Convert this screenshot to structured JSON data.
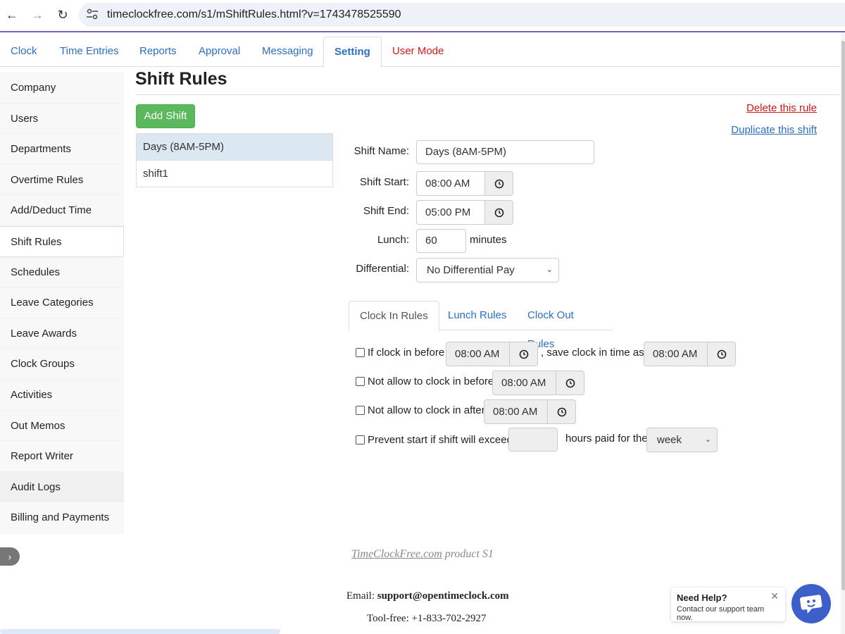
{
  "browser": {
    "url": "timeclockfree.com/s1/mShiftRules.html?v=1743478525590",
    "back_icon": "←",
    "forward_icon": "→",
    "reload_icon": "↻"
  },
  "top_tabs": [
    {
      "label": "Clock"
    },
    {
      "label": "Time Entries"
    },
    {
      "label": "Reports"
    },
    {
      "label": "Approval"
    },
    {
      "label": "Messaging"
    },
    {
      "label": "Setting",
      "active": true
    },
    {
      "label": "User Mode"
    }
  ],
  "sidebar": {
    "items": [
      {
        "label": "Company"
      },
      {
        "label": "Users"
      },
      {
        "label": "Departments"
      },
      {
        "label": "Overtime Rules"
      },
      {
        "label": "Add/Deduct Time"
      },
      {
        "label": "Shift Rules",
        "active": true
      },
      {
        "label": "Schedules"
      },
      {
        "label": "Leave Categories"
      },
      {
        "label": "Leave Awards"
      },
      {
        "label": "Clock Groups"
      },
      {
        "label": "Activities"
      },
      {
        "label": "Out Memos"
      },
      {
        "label": "Report Writer"
      },
      {
        "label": "Audit Logs"
      },
      {
        "label": "Billing and Payments"
      }
    ],
    "toggle_icon": "›"
  },
  "page": {
    "title": "Shift Rules",
    "add_shift_label": "Add Shift",
    "delete_link": "Delete this rule",
    "duplicate_link": "Duplicate this shift"
  },
  "shifts": [
    {
      "name": "Days (8AM-5PM)",
      "selected": true
    },
    {
      "name": "shift1"
    }
  ],
  "form": {
    "shift_name_label": "Shift Name:",
    "shift_name_value": "Days (8AM-5PM)",
    "shift_start_label": "Shift Start:",
    "shift_start_value": "08:00 AM",
    "shift_end_label": "Shift End:",
    "shift_end_value": "05:00 PM",
    "lunch_label": "Lunch:",
    "lunch_value": "60",
    "lunch_unit": "minutes",
    "differential_label": "Differential:",
    "differential_value": "No Differential Pay"
  },
  "rule_tabs": [
    {
      "label": "Clock In Rules",
      "active": true
    },
    {
      "label": "Lunch Rules"
    },
    {
      "label": "Clock Out Rules"
    }
  ],
  "clock_in_rules": {
    "rule1_label": "If clock in before",
    "rule1_time": "08:00 AM",
    "rule1_mid": ", save clock in time as",
    "rule1_time2": "08:00 AM",
    "rule2_label": "Not allow to clock in before",
    "rule2_time": "08:00 AM",
    "rule3_label": "Not allow to clock in after",
    "rule3_time": "08:00 AM",
    "rule4_label": "Prevent start if shift will exceed",
    "rule4_hours": "",
    "rule4_mid": "hours paid for the",
    "rule4_period": "week"
  },
  "footer": {
    "product_link": "TimeClockFree.com",
    "product_suffix": " product S1",
    "email_label": "Email: ",
    "email_value": "support@opentimeclock.com",
    "phone": "Tool-free: +1-833-702-2927"
  },
  "help": {
    "title": "Need Help?",
    "subtitle": "Contact our support team now.",
    "close_icon": "✕"
  },
  "colors": {
    "accent_blue": "#2a6fc0",
    "danger_red": "#d21818",
    "success_green": "#5cb85c",
    "help_bubble": "#3d5fc9"
  }
}
